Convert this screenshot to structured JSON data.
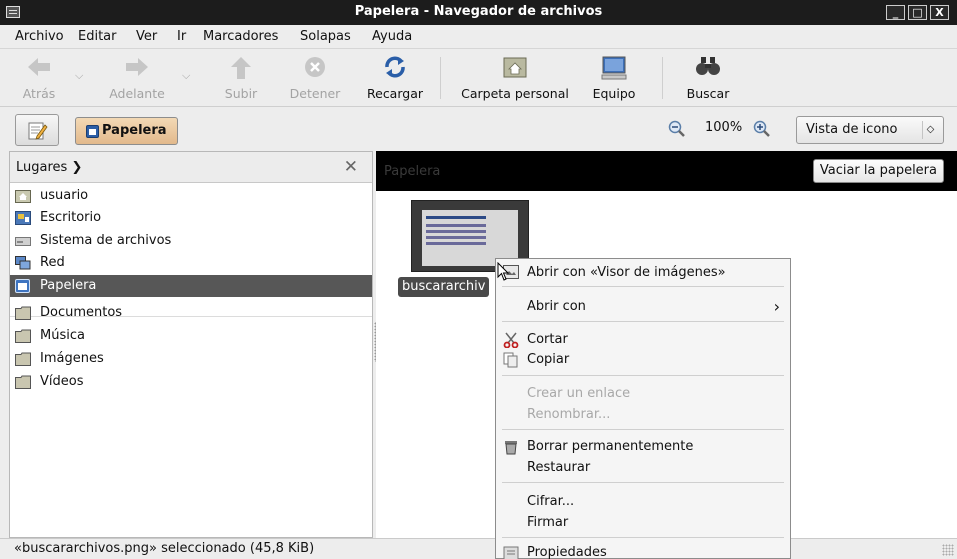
{
  "window": {
    "title": "Papelera - Navegador de archivos",
    "buttons": [
      "_",
      "□",
      "X"
    ]
  },
  "menubar": [
    "Archivo",
    "Editar",
    "Ver",
    "Ir",
    "Marcadores",
    "Solapas",
    "Ayuda"
  ],
  "toolbar": {
    "back": "Atrás",
    "forward": "Adelante",
    "up": "Subir",
    "stop": "Detener",
    "reload": "Recargar",
    "home": "Carpeta personal",
    "computer": "Equipo",
    "search": "Buscar"
  },
  "location": {
    "current": "Papelera",
    "zoom": "100%",
    "view": "Vista de icono"
  },
  "sidebar": {
    "header": "Lugares",
    "items": [
      "usuario",
      "Escritorio",
      "Sistema de archivos",
      "Red",
      "Papelera"
    ],
    "bookmarks": [
      "Documentos",
      "Música",
      "Imágenes",
      "Vídeos"
    ]
  },
  "main": {
    "header_title": "Papelera",
    "empty_trash": "Vaciar la papelera",
    "file_label": "buscararchiv"
  },
  "context_menu": {
    "open_with_viewer": "Abrir con «Visor de imágenes»",
    "open_with": "Abrir con",
    "cut": "Cortar",
    "copy": "Copiar",
    "make_link": "Crear un enlace",
    "rename": "Renombrar...",
    "delete_perm": "Borrar permanentemente",
    "restore": "Restaurar",
    "encrypt": "Cifrar...",
    "sign": "Firmar",
    "properties": "Propiedades"
  },
  "status": "«buscararchivos.png» seleccionado (45,8 KiB)"
}
